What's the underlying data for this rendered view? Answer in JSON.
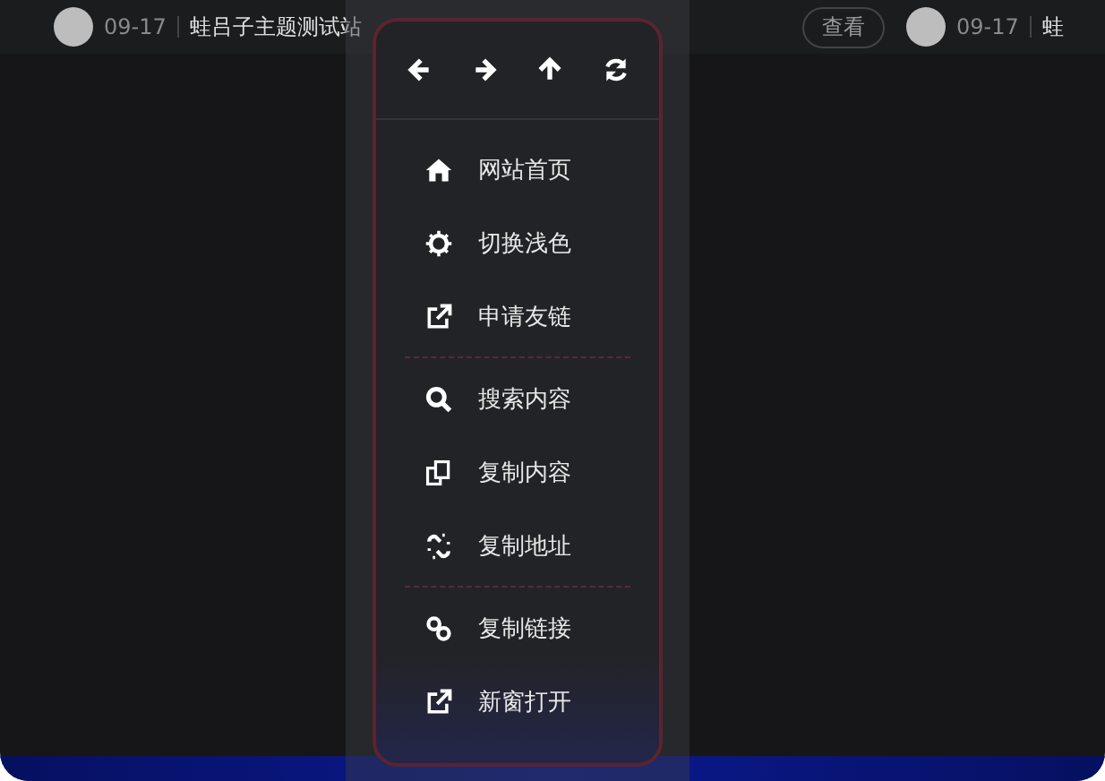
{
  "background_posts": [
    {
      "date": "09-17",
      "title": "蛙吕子主题测试站",
      "button": "查看"
    },
    {
      "date": "09-17",
      "title": "蛙"
    }
  ],
  "menu": {
    "nav_buttons": [
      {
        "kind": "back"
      },
      {
        "kind": "forward"
      },
      {
        "kind": "up"
      },
      {
        "kind": "refresh"
      }
    ],
    "groups": [
      [
        {
          "kind": "home",
          "label": "网站首页"
        },
        {
          "kind": "theme",
          "label": "切换浅色"
        },
        {
          "kind": "external",
          "label": "申请友链"
        }
      ],
      [
        {
          "kind": "search",
          "label": "搜索内容"
        },
        {
          "kind": "copy",
          "label": "复制内容"
        },
        {
          "kind": "unlink",
          "label": "复制地址"
        }
      ],
      [
        {
          "kind": "link",
          "label": "复制链接"
        },
        {
          "kind": "external",
          "label": "新窗打开"
        }
      ]
    ]
  }
}
